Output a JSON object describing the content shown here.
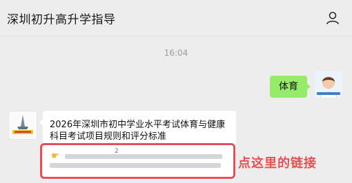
{
  "header": {
    "title": "深圳初升高升学指导",
    "profile_icon": "user-outline-icon"
  },
  "chat": {
    "timestamp": "16:04",
    "outgoing": {
      "text": "体育"
    },
    "incoming": {
      "text": "2026年深圳市初中学业水平考试体育与健康科目考试项目规则和评分标准",
      "link_mark": "2",
      "hand_icon": "pointing-hand-icon"
    }
  },
  "annotation": {
    "text": "点这里的链接",
    "color": "#e84f55"
  },
  "colors": {
    "outgoing_bubble": "#95ec69",
    "background": "#ededed",
    "accent_red": "#e84f55"
  }
}
